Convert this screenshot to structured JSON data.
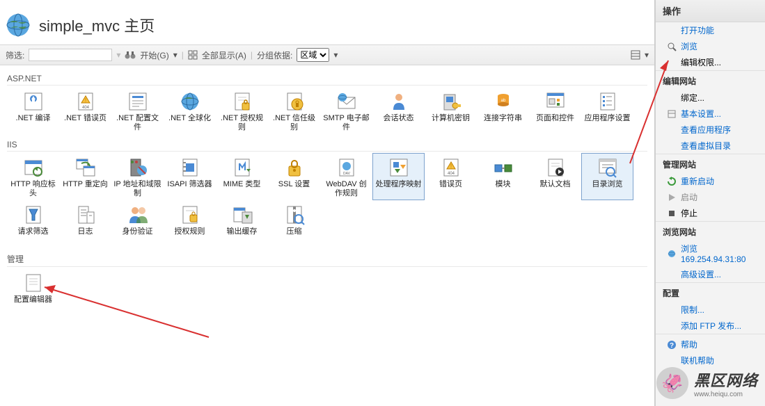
{
  "page_title": "simple_mvc 主页",
  "toolbar": {
    "filter_label": "筛选:",
    "filter_value": "",
    "start_label": "开始(G)",
    "show_all": "全部显示(A)",
    "group_by_label": "分组依据:",
    "group_by_value": "区域"
  },
  "sections": {
    "aspnet": "ASP.NET",
    "iis": "IIS",
    "mgmt": "管理"
  },
  "aspnet_items": [
    {
      "id": "net-compile",
      "label": ".NET 编译"
    },
    {
      "id": "net-error-pages",
      "label": ".NET 错误页"
    },
    {
      "id": "net-profiles",
      "label": ".NET 配置文件"
    },
    {
      "id": "net-globalization",
      "label": ".NET 全球化"
    },
    {
      "id": "net-authz",
      "label": ".NET 授权规则"
    },
    {
      "id": "net-trust",
      "label": ".NET 信任级别"
    },
    {
      "id": "smtp",
      "label": "SMTP 电子邮件"
    },
    {
      "id": "session-state",
      "label": "会话状态"
    },
    {
      "id": "machine-key",
      "label": "计算机密钥"
    },
    {
      "id": "conn-strings",
      "label": "连接字符串"
    },
    {
      "id": "pages-controls",
      "label": "页面和控件"
    },
    {
      "id": "app-settings",
      "label": "应用程序设置"
    }
  ],
  "iis_items": [
    {
      "id": "http-response",
      "label": "HTTP 响应标头"
    },
    {
      "id": "http-redirect",
      "label": "HTTP 重定向"
    },
    {
      "id": "ip-domain",
      "label": "IP 地址和域限制"
    },
    {
      "id": "isapi",
      "label": "ISAPI 筛选器"
    },
    {
      "id": "mime",
      "label": "MIME 类型"
    },
    {
      "id": "ssl",
      "label": "SSL 设置"
    },
    {
      "id": "webdav",
      "label": "WebDAV 创作规则"
    },
    {
      "id": "handler-map",
      "label": "处理程序映射",
      "selected": true
    },
    {
      "id": "error-pages",
      "label": "错误页"
    },
    {
      "id": "modules",
      "label": "模块"
    },
    {
      "id": "default-doc",
      "label": "默认文档"
    },
    {
      "id": "dir-browse",
      "label": "目录浏览",
      "selected": true
    },
    {
      "id": "req-filter",
      "label": "请求筛选"
    },
    {
      "id": "logging",
      "label": "日志"
    },
    {
      "id": "authn",
      "label": "身份验证"
    },
    {
      "id": "authz-rules",
      "label": "授权规则"
    },
    {
      "id": "output-cache",
      "label": "输出缓存"
    },
    {
      "id": "compression",
      "label": "压缩"
    }
  ],
  "mgmt_items": [
    {
      "id": "config-editor",
      "label": "配置编辑器"
    }
  ],
  "actions": {
    "title": "操作",
    "open_feature": "打开功能",
    "browse": "浏览",
    "edit_perm": "编辑权限...",
    "edit_site_hdr": "编辑网站",
    "bindings": "绑定...",
    "basic_settings": "基本设置...",
    "view_apps": "查看应用程序",
    "view_vdirs": "查看虚拟目录",
    "manage_site_hdr": "管理网站",
    "restart": "重新启动",
    "start": "启动",
    "stop": "停止",
    "browse_site_hdr": "浏览网站",
    "browse_addr": "浏览 169.254.94.31:80",
    "adv_settings": "高级设置...",
    "config_hdr": "配置",
    "limits": "限制...",
    "add_ftp": "添加 FTP 发布...",
    "help": "帮助",
    "online_help": "联机帮助"
  },
  "watermark": {
    "brand": "黑区网络",
    "url": "www.heiqu.com"
  }
}
